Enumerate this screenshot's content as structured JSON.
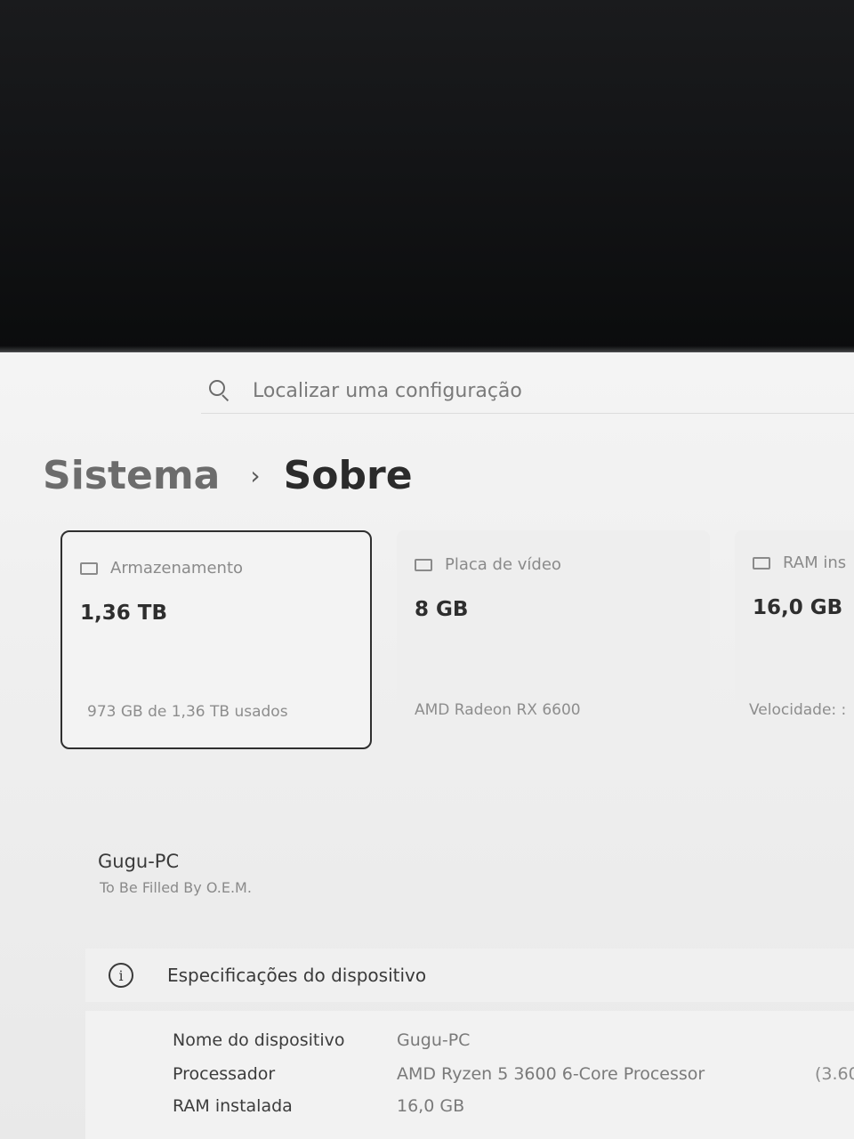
{
  "search": {
    "placeholder": "Localizar uma configuração"
  },
  "breadcrumb": {
    "parent": "Sistema",
    "current": "Sobre"
  },
  "cards": [
    {
      "title": "Armazenamento",
      "value": "1,36 TB",
      "detail": "973 GB de 1,36 TB usados",
      "icon": "storage-icon"
    },
    {
      "title": "Placa de vídeo",
      "value": "8 GB",
      "detail": "AMD Radeon RX 6600",
      "icon": "display-icon"
    },
    {
      "title": "RAM ins",
      "value": "16,0 GB",
      "detail": "Velocidade: :",
      "icon": "memory-icon"
    }
  ],
  "device": {
    "name": "Gugu-PC",
    "oem": "To Be Filled By O.E.M."
  },
  "specs": {
    "title": "Especificações do dispositivo",
    "rows": [
      {
        "label": "Nome do dispositivo",
        "value": "Gugu-PC",
        "extra": ""
      },
      {
        "label": "Processador",
        "value": "AMD Ryzen 5 3600 6-Core Processor",
        "extra": "(3.60"
      },
      {
        "label": "RAM instalada",
        "value": "16,0 GB",
        "extra": ""
      }
    ]
  }
}
